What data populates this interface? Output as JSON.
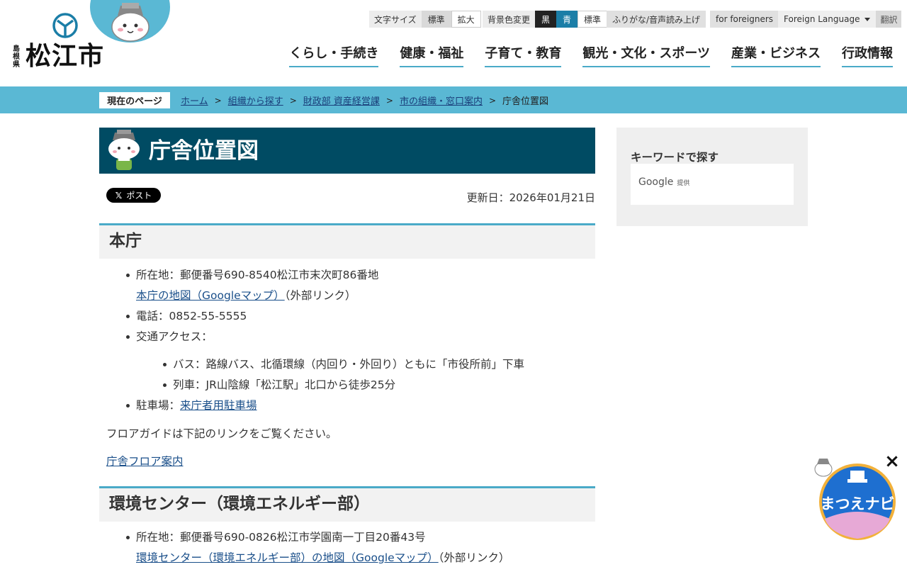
{
  "header": {
    "prefecture": "島根県",
    "city": "松江市",
    "text_size": {
      "label": "文字サイズ",
      "options": [
        "標準",
        "拡大"
      ]
    },
    "bg_color": {
      "label": "背景色変更",
      "options": [
        "黒",
        "青",
        "標準"
      ]
    },
    "furigana": "ふりがな/音声読み上げ",
    "foreigners": "for foreigners",
    "foreign_language": "Foreign Language",
    "translate": "翻訳"
  },
  "nav": [
    "くらし・手続き",
    "健康・福祉",
    "子育て・教育",
    "観光・文化・スポーツ",
    "産業・ビジネス",
    "行政情報"
  ],
  "breadcrumb": {
    "current_label": "現在のページ",
    "items": [
      "ホーム",
      "組織から探す",
      "財政部 資産経営課",
      "市の組織・窓口案内"
    ],
    "current": "庁舎位置図"
  },
  "page": {
    "title": "庁舎位置図",
    "post_button": "ポスト",
    "updated": "更新日：2026年01月21日"
  },
  "sections": [
    {
      "heading": "本庁",
      "address": "所在地：郵便番号690-8540松江市末次町86番地",
      "map_link": "本庁の地図（Googleマップ）",
      "external": "（外部リンク）",
      "phone": "電話：0852-55-5555",
      "access_label": "交通アクセス：",
      "access": [
        "バス：路線バス、北循環線（内回り・外回り）ともに「市役所前」下車",
        "列車：JR山陰線「松江駅」北口から徒歩25分"
      ],
      "parking_label": "駐車場：",
      "parking_link": "来庁者用駐車場",
      "floor_text": "フロアガイドは下記のリンクをご覧ください。",
      "floor_link": "庁舎フロア案内"
    },
    {
      "heading": "環境センター（環境エネルギー部）",
      "address": "所在地：郵便番号690-0826松江市学園南一丁目20番43号",
      "map_link": "環境センター（環境エネルギー部）の地図（Googleマップ）",
      "external": "（外部リンク）"
    }
  ],
  "sidebar": {
    "title": "キーワードで探す",
    "google": "Google",
    "provided": "提供"
  },
  "floating": {
    "label": "まつえナビ",
    "close": "×"
  },
  "colors": {
    "accent": "#5ab8d4",
    "title_bg": "#004b63",
    "link": "#1a4f8a"
  }
}
